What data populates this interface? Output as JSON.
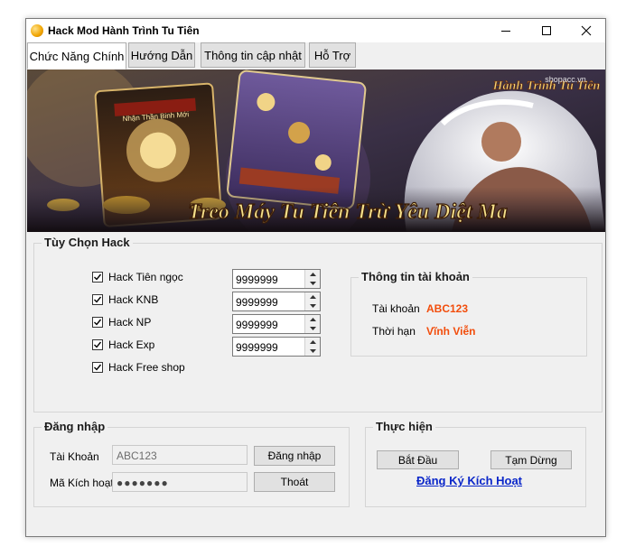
{
  "window": {
    "title": "Hack Mod Hành Trình Tu Tiên"
  },
  "tabs": [
    {
      "label": "Chức Năng Chính"
    },
    {
      "label": "Hướng Dẫn"
    },
    {
      "label": "Thông tin cập nhật"
    },
    {
      "label": "Hỗ Trợ"
    }
  ],
  "banner": {
    "slogan": "Treo Máy Tu Tiên Trừ Yêu Diệt Ma",
    "logo_text": "Hành Trình Tu Tiên",
    "watermark": "shopacc.vn",
    "card_text": "Nhận Thần Binh Mới"
  },
  "hack_options": {
    "title": "Tùy Chọn Hack",
    "items": [
      {
        "label": "Hack Tiên ngọc",
        "checked": true,
        "value": "9999999"
      },
      {
        "label": "Hack KNB",
        "checked": true,
        "value": "9999999"
      },
      {
        "label": "Hack NP",
        "checked": true,
        "value": "9999999"
      },
      {
        "label": "Hack Exp",
        "checked": true,
        "value": "9999999"
      },
      {
        "label": "Hack Free shop",
        "checked": true
      }
    ]
  },
  "account_info": {
    "title": "Thông tin tài khoản",
    "account_label": "Tài khoản",
    "account_value": "ABC123",
    "duration_label": "Thời hạn",
    "duration_value": "Vĩnh Viễn"
  },
  "login": {
    "title": "Đăng nhập",
    "account_label": "Tài Khoản",
    "account_value": "ABC123",
    "code_label": "Mã Kích hoạt",
    "code_value": "●●●●●●●",
    "login_button": "Đăng nhập",
    "exit_button": "Thoát"
  },
  "actions": {
    "title": "Thực hiện",
    "start_button": "Bắt Đầu",
    "pause_button": "Tạm Dừng",
    "register_link": "Đăng Ký Kích Hoạt"
  },
  "colors": {
    "accent_orange": "#f24d0c",
    "link_blue": "#0a26c9"
  }
}
